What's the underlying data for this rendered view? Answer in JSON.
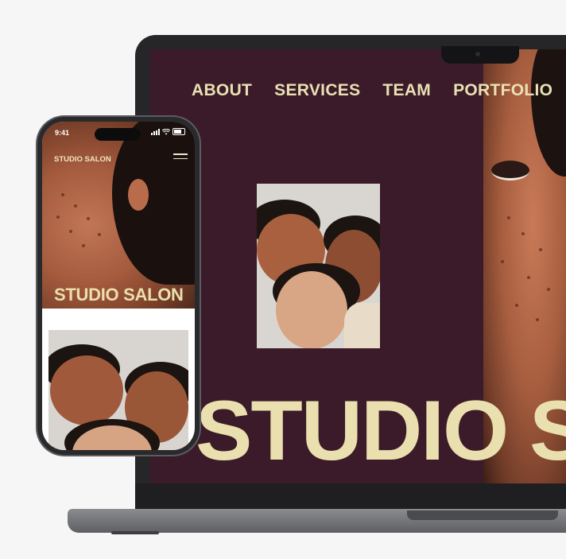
{
  "desktop": {
    "nav": [
      "ABOUT",
      "SERVICES",
      "TEAM",
      "PORTFOLIO"
    ],
    "hero_title": "STUDIO SALON"
  },
  "phone": {
    "status": {
      "time": "9:41"
    },
    "brand": "STUDIO SALON",
    "hero_title": "STUDIO SALON"
  },
  "colors": {
    "site_background": "#3b1b29",
    "title_cream": "#eadfae",
    "page_background": "#f6f6f6"
  },
  "icons": [
    "hamburger-menu-icon",
    "signal-icon",
    "wifi-icon",
    "battery-icon"
  ]
}
